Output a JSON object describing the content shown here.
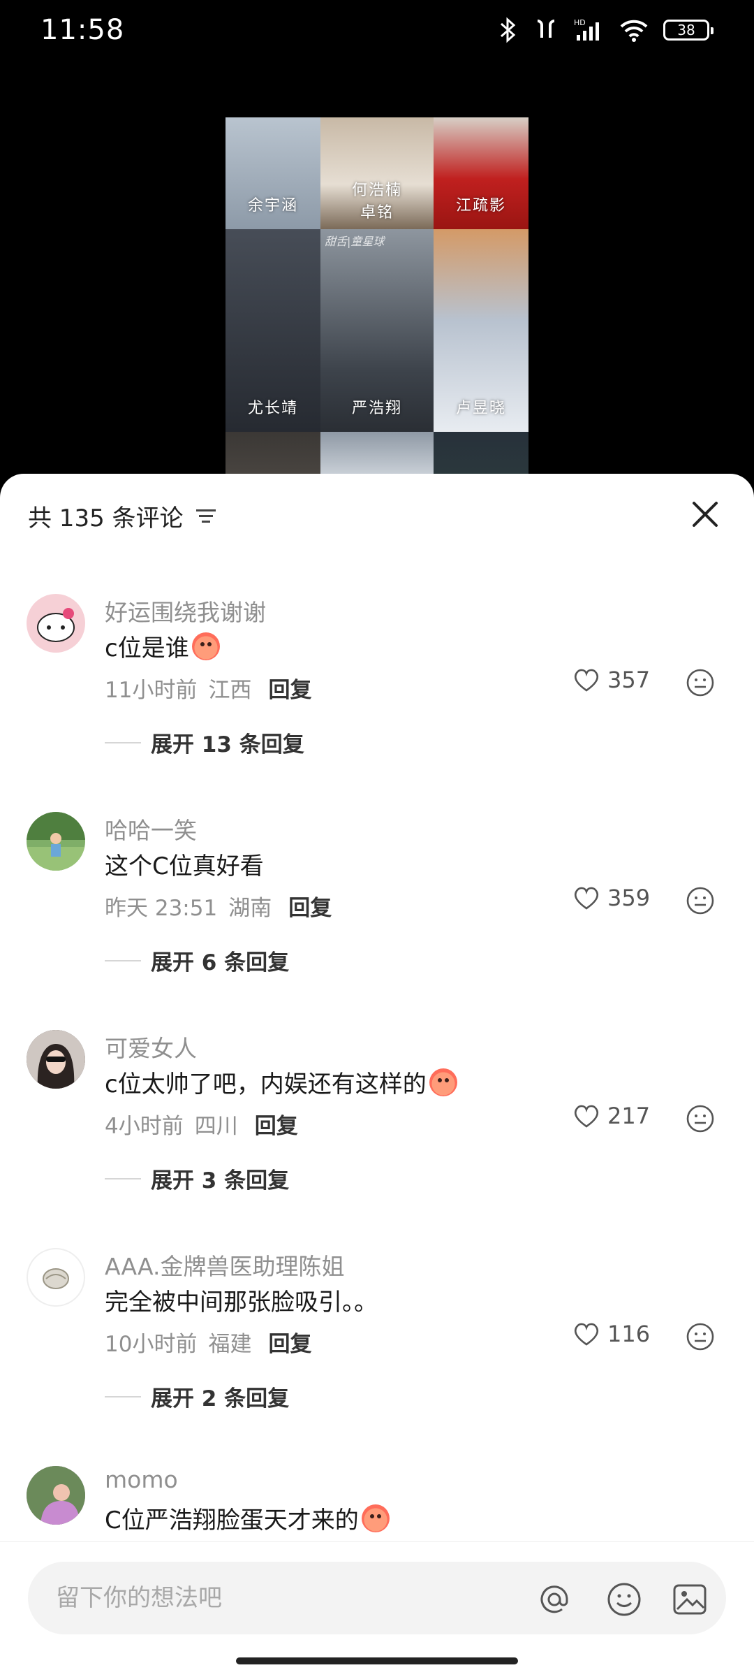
{
  "status_bar": {
    "time": "11:58",
    "battery": "38",
    "icons": [
      "bluetooth-icon",
      "earbuds-icon",
      "hd-signal-icon",
      "wifi-icon",
      "battery-icon"
    ]
  },
  "video": {
    "captions": [
      "余宇涵",
      "何浩楠\n卓铭",
      "江疏影",
      "尤长靖",
      "严浩翔",
      "卢昱晓"
    ],
    "watermark": "甜舌|童星球"
  },
  "comments_panel": {
    "title": "共 135 条评论",
    "filter_icon": "filter-icon",
    "close_icon": "close-icon"
  },
  "comments": [
    {
      "user": "好运围绕我谢谢",
      "text": "c位是谁",
      "emoji": true,
      "time": "11小时前",
      "location": "江西",
      "reply_label": "回复",
      "likes": "357",
      "expand": "展开 13 条回复",
      "avatar_color": "#f6d0d6"
    },
    {
      "user": "哈哈一笑",
      "text": "这个C位真好看",
      "emoji": false,
      "time": "昨天 23:51",
      "location": "湖南",
      "reply_label": "回复",
      "likes": "359",
      "expand": "展开 6 条回复",
      "avatar_color": "#7fae68"
    },
    {
      "user": "可爱女人",
      "text": "c位太帅了吧，内娱还有这样的",
      "emoji": true,
      "time": "4小时前",
      "location": "四川",
      "reply_label": "回复",
      "likes": "217",
      "expand": "展开 3 条回复",
      "avatar_color": "#3a3230"
    },
    {
      "user": "AAA.金牌兽医助理陈姐",
      "text": "完全被中间那张脸吸引。。",
      "emoji": false,
      "time": "10小时前",
      "location": "福建",
      "reply_label": "回复",
      "likes": "116",
      "expand": "展开 2 条回复",
      "avatar_color": "#f1f1f1"
    },
    {
      "user": "momo",
      "text": "C位严浩翔脸蛋天才来的",
      "emoji": true,
      "avatar_color": "#8a6d90"
    }
  ],
  "input": {
    "placeholder": "留下你的想法吧",
    "icons": [
      "mention-icon",
      "emoji-icon",
      "image-icon"
    ]
  }
}
